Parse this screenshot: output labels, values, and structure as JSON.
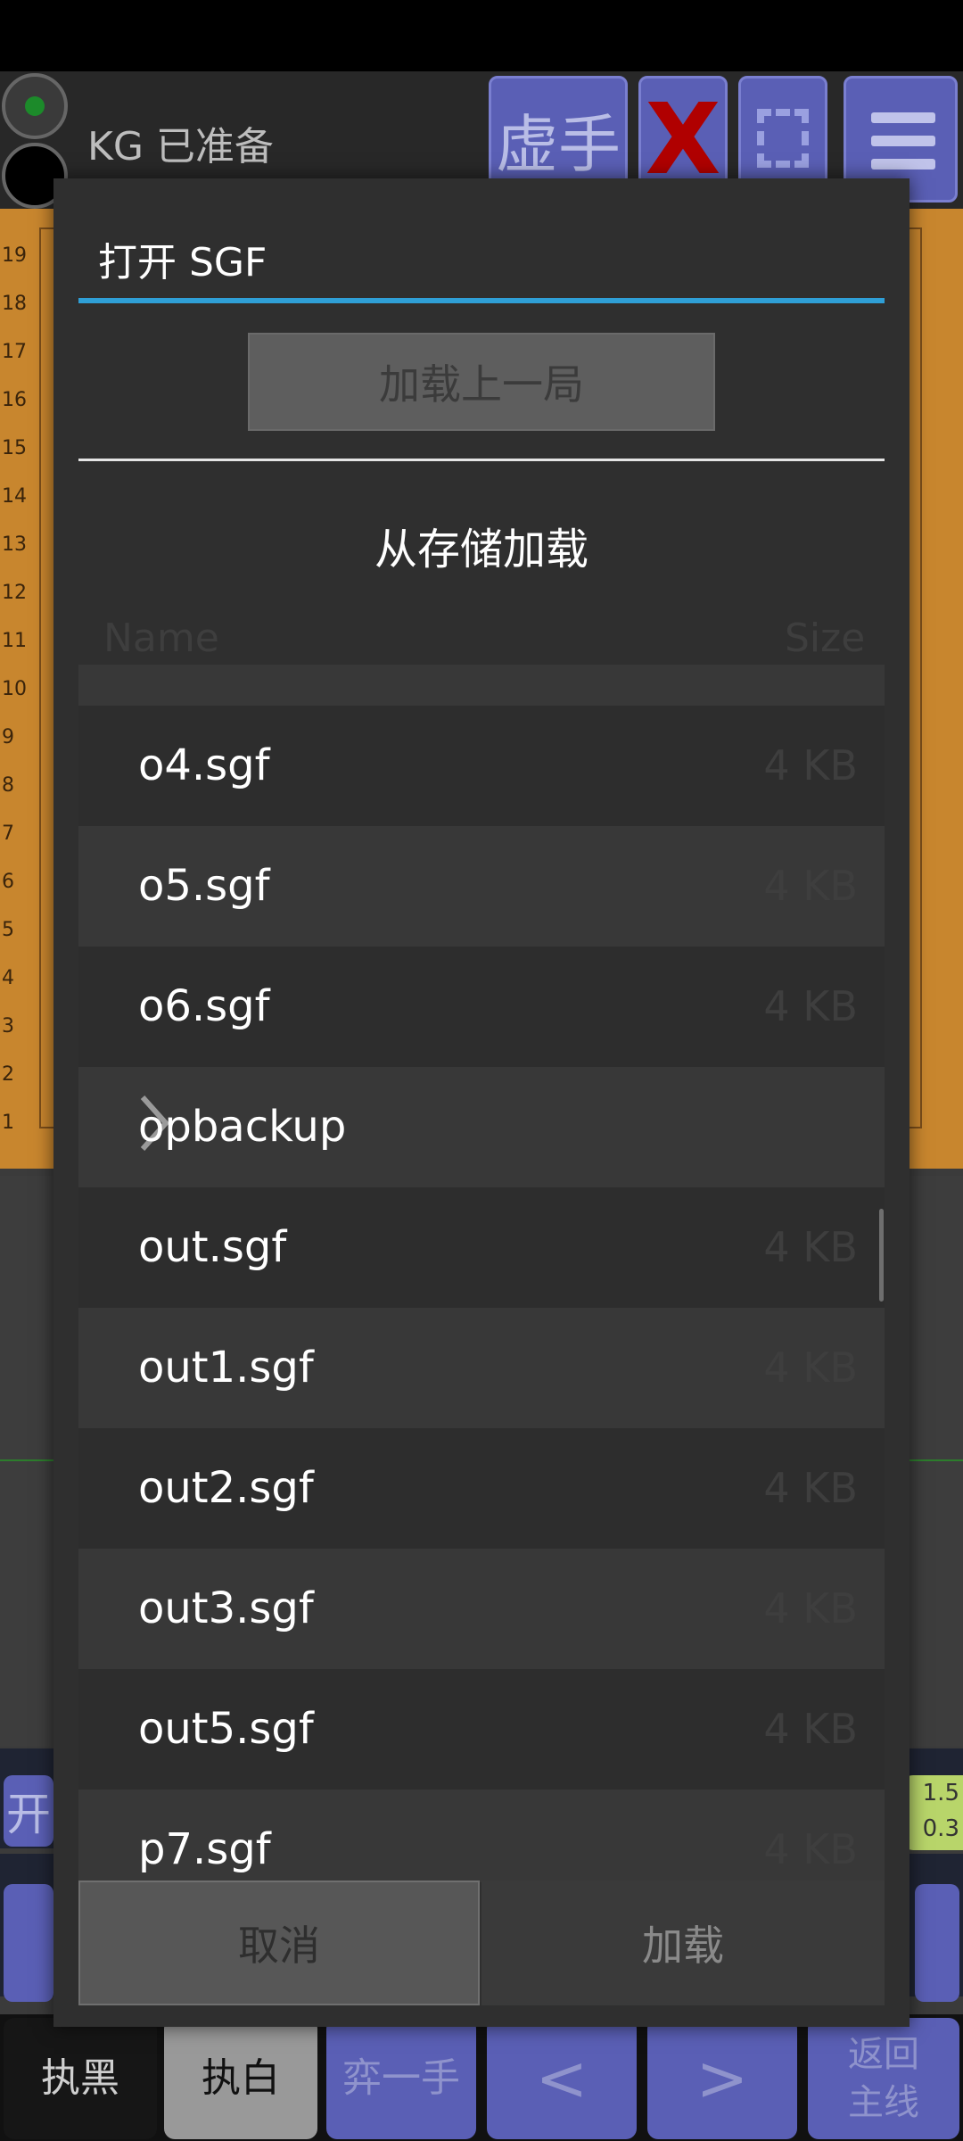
{
  "app": {
    "status_text": "KG  已准备",
    "toolbar": {
      "virtual_label": "虚手",
      "x_label": "X"
    },
    "board": {
      "row_numbers": [
        "19",
        "18",
        "17",
        "16",
        "15",
        "14",
        "13",
        "12",
        "11",
        "10",
        "9",
        "8",
        "7",
        "6",
        "5",
        "4",
        "3",
        "2",
        "1"
      ]
    },
    "partial_left_label": "开",
    "score": {
      "line1": "1.5",
      "line2": "0.3"
    },
    "bottom_bar": {
      "black": "执黑",
      "white": "执白",
      "pass": "弈一手",
      "prev": "<",
      "next": ">",
      "main_line": "返回\n主线"
    }
  },
  "dialog": {
    "title": "打开 SGF",
    "load_last_label": "加载上一局",
    "load_from_storage_label": "从存储加载",
    "columns": {
      "name": "Name",
      "size": "Size"
    },
    "files": [
      {
        "name": "o4.sgf",
        "size": "4 KB",
        "type": "file"
      },
      {
        "name": "o5.sgf",
        "size": "4 KB",
        "type": "file"
      },
      {
        "name": "o6.sgf",
        "size": "4 KB",
        "type": "file"
      },
      {
        "name": "opbackup",
        "size": "",
        "type": "folder"
      },
      {
        "name": "out.sgf",
        "size": "4 KB",
        "type": "file"
      },
      {
        "name": "out1.sgf",
        "size": "4 KB",
        "type": "file"
      },
      {
        "name": "out2.sgf",
        "size": "4 KB",
        "type": "file"
      },
      {
        "name": "out3.sgf",
        "size": "4 KB",
        "type": "file"
      },
      {
        "name": "out5.sgf",
        "size": "4 KB",
        "type": "file"
      },
      {
        "name": "p7.sgf",
        "size": "4 KB",
        "type": "file"
      }
    ],
    "cancel_label": "取消",
    "load_label": "加载",
    "accent_color": "#2f9fd6"
  }
}
